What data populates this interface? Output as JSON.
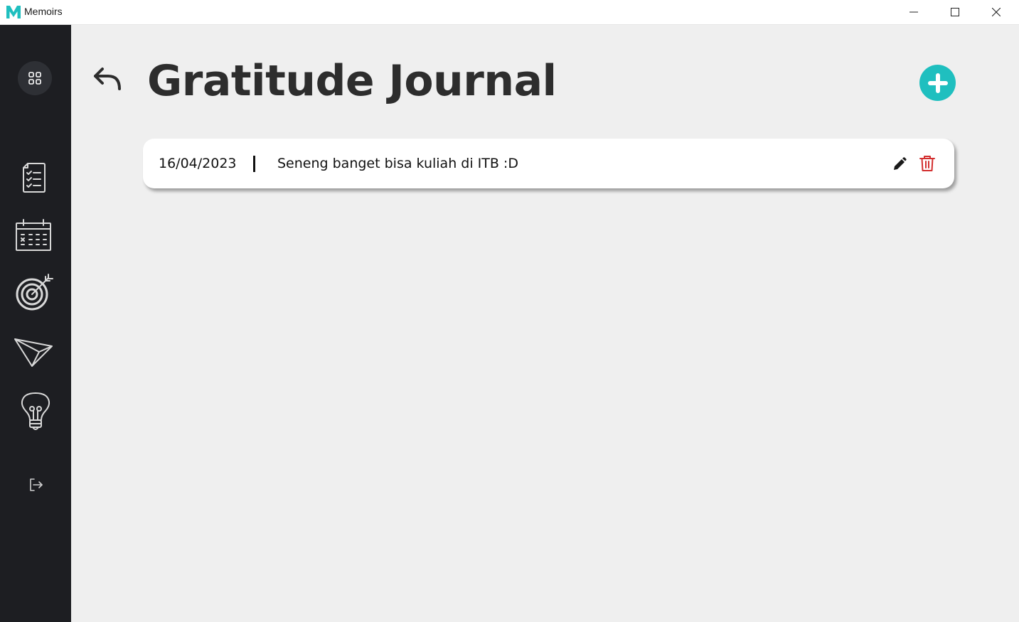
{
  "window": {
    "title": "Memoirs",
    "logo_letter": "M",
    "brand_color": "#1fbfbf",
    "controls": [
      "minimize-icon",
      "maximize-icon",
      "close-icon"
    ]
  },
  "sidebar": {
    "menu_icon": "grid-icon",
    "items": [
      {
        "name": "journal",
        "icon": "checklist-icon"
      },
      {
        "name": "calendar",
        "icon": "calendar-icon"
      },
      {
        "name": "goals",
        "icon": "target-icon"
      },
      {
        "name": "send",
        "icon": "paper-plane-icon"
      },
      {
        "name": "ideas",
        "icon": "lightbulb-icon"
      }
    ],
    "logout_icon": "logout-icon"
  },
  "header": {
    "title": "Gratitude Journal",
    "back_icon": "back-arrow-icon",
    "add_icon": "plus-icon"
  },
  "entries": [
    {
      "date": "16/04/2023",
      "text": "Seneng banget bisa kuliah di ITB :D"
    }
  ],
  "colors": {
    "sidebar": "#1d1e22",
    "background": "#efefef",
    "accent": "#1fbfbf",
    "delete": "#d32f2f"
  }
}
